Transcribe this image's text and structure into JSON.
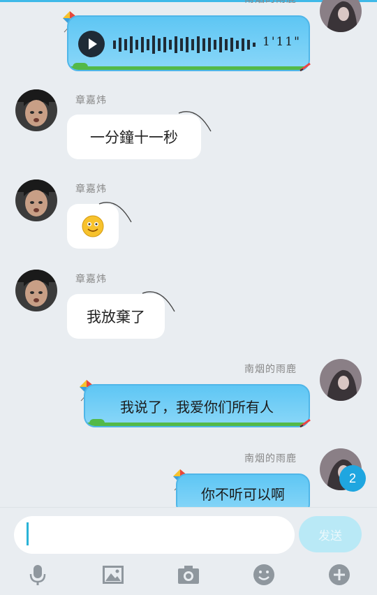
{
  "colors": {
    "accent": "#3fb9e8",
    "bubble_right": "#74cff6",
    "badge": "#1fa6e0",
    "grass": "#53b948"
  },
  "messages": [
    {
      "side": "right",
      "type": "voice",
      "name": "南烟的雨鹿",
      "duration": "1'11\""
    },
    {
      "side": "left",
      "name": "章嘉炜",
      "text": "一分鐘十一秒"
    },
    {
      "side": "left",
      "name": "章嘉炜",
      "emoji": "smile-emoji"
    },
    {
      "side": "left",
      "name": "章嘉炜",
      "text": "我放棄了"
    },
    {
      "side": "right",
      "name": "南烟的雨鹿",
      "text": "我说了，我爱你们所有人"
    },
    {
      "side": "right",
      "name": "南烟的雨鹿",
      "text": "你不听可以啊"
    }
  ],
  "badge": {
    "count": "2"
  },
  "input": {
    "placeholder": ""
  },
  "send": {
    "label": "发送"
  },
  "toolbar": [
    "microphone-icon",
    "image-icon",
    "camera-icon",
    "emoji-icon",
    "plus-icon"
  ]
}
